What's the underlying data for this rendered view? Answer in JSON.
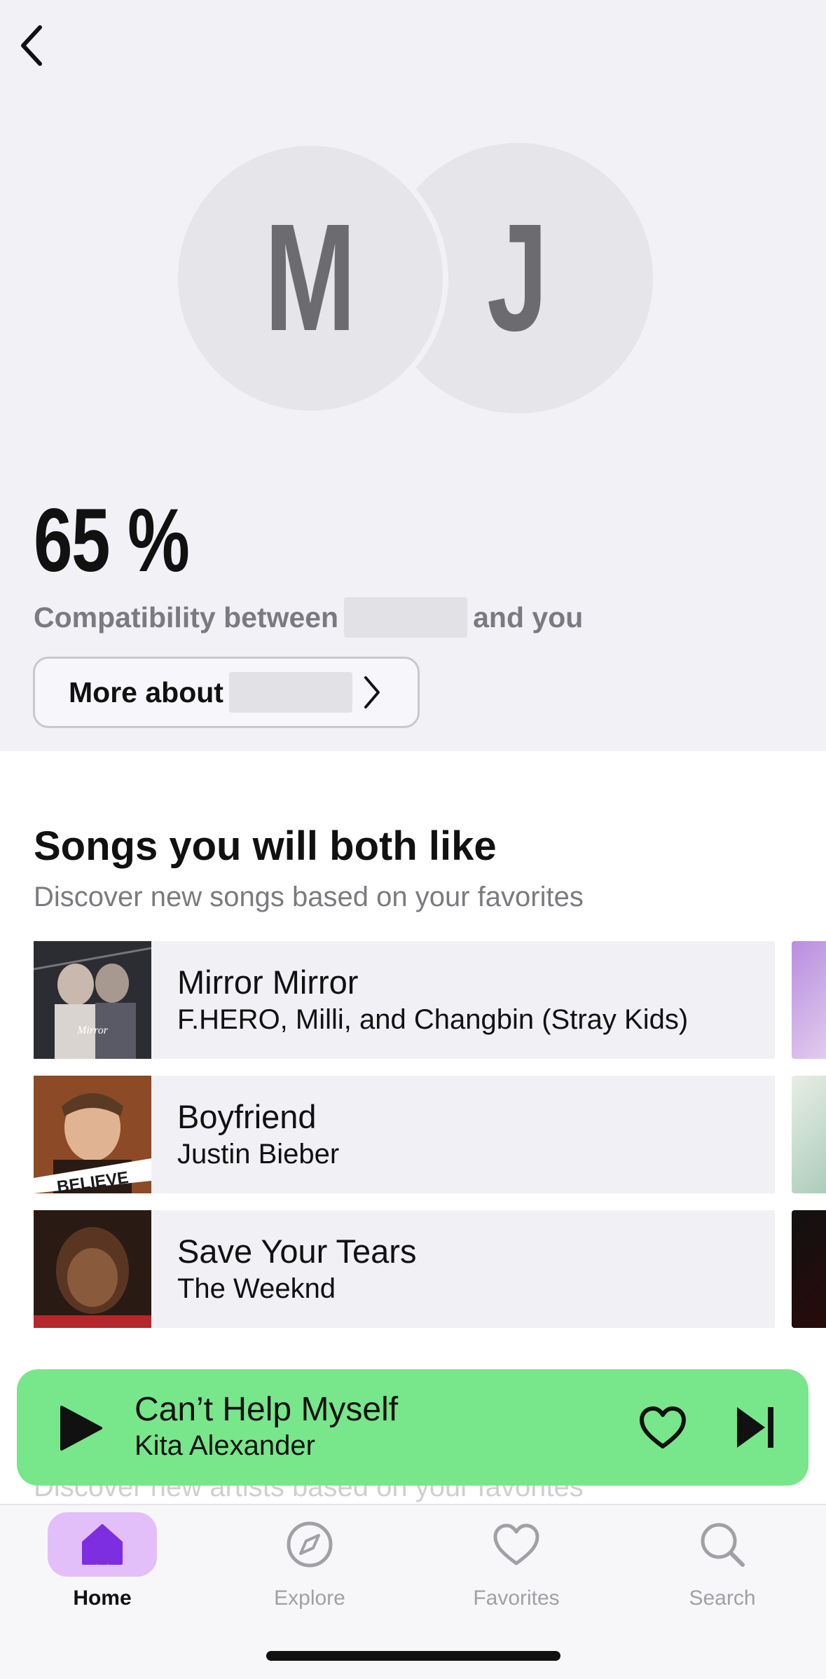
{
  "header": {
    "back_icon": "chevron-left-icon"
  },
  "avatars": [
    {
      "initial": "M"
    },
    {
      "initial": "J"
    }
  ],
  "compatibility": {
    "percent": "65 %",
    "text_prefix": "Compatibility between",
    "text_suffix": "and you"
  },
  "more_button": {
    "label": "More about"
  },
  "songs_section": {
    "title": "Songs you will both like",
    "subtitle": "Discover new songs based on your favorites",
    "songs": [
      {
        "title": "Mirror Mirror",
        "artist": "F.HERO, Milli, and Changbin (Stray Kids)"
      },
      {
        "title": "Boyfriend",
        "artist": "Justin Bieber",
        "cover_text": "BELIEVE"
      },
      {
        "title": "Save Your Tears",
        "artist": "The Weeknd"
      }
    ]
  },
  "next_section_subtitle": "Discover new artists based on your favorites",
  "mini_player": {
    "title": "Can’t Help Myself",
    "artist": "Kita Alexander",
    "background": "#78e68a"
  },
  "tab_bar": {
    "tabs": [
      {
        "label": "Home",
        "icon": "house-icon",
        "active": true
      },
      {
        "label": "Explore",
        "icon": "compass-icon",
        "active": false
      },
      {
        "label": "Favorites",
        "icon": "heart-icon",
        "active": false
      },
      {
        "label": "Search",
        "icon": "magnifier-icon",
        "active": false
      }
    ],
    "active_color": "#7d2ee0",
    "active_bg": "#e3bff9"
  }
}
